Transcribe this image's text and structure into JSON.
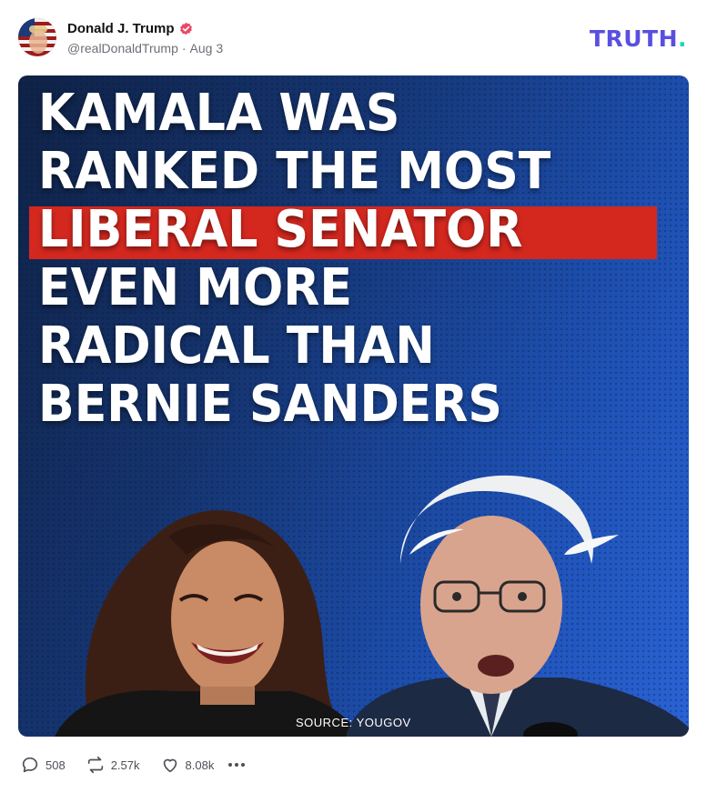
{
  "post": {
    "author_name": "Donald J. Trump",
    "handle": "@realDonaldTrump",
    "separator": "·",
    "date": "Aug 3",
    "verified_icon": "verified-badge-icon",
    "brand_logo_text": "TRUTH",
    "brand_logo_dot": ".",
    "colors": {
      "brand": "#5a4fe0",
      "brand_dot": "#1fd6b0",
      "verified": "#e94a67",
      "highlight": "#d4281f"
    }
  },
  "image": {
    "headline_lines": [
      "KAMALA WAS",
      "RANKED THE MOST",
      "LIBERAL SENATOR",
      "EVEN MORE",
      "RADICAL THAN",
      "BERNIE SANDERS"
    ],
    "highlighted_line_index": 2,
    "source_caption": "SOURCE: YOUGOV"
  },
  "actions": {
    "replies": "508",
    "retruths": "2.57k",
    "likes": "8.08k",
    "reply_icon": "comment-icon",
    "retruth_icon": "repost-icon",
    "like_icon": "heart-icon",
    "more_icon": "more-options-icon"
  }
}
